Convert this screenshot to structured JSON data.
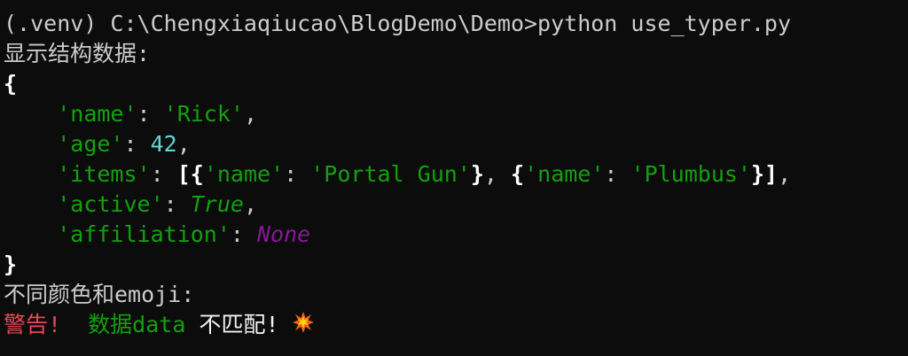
{
  "terminal": {
    "command_line": "(.venv) C:\\Chengxiaqiucao\\BlogDemo\\Demo>python use_typer.py",
    "heading_structured": "显示结构数据:",
    "open_brace": "{",
    "close_brace": "}",
    "indent": "    ",
    "rows": {
      "name": {
        "key": "'name'",
        "sep": ": ",
        "value": "'Rick'",
        "trail": ","
      },
      "age": {
        "key": "'age'",
        "sep": ": ",
        "value": "42",
        "trail": ","
      },
      "items": {
        "key": "'items'",
        "sep": ": ",
        "open_list": "[",
        "item1_open": "{",
        "item1_key": "'name'",
        "item1_sep": ": ",
        "item1_value": "'Portal Gun'",
        "item1_close": "}",
        "between": ", ",
        "item2_open": "{",
        "item2_key": "'name'",
        "item2_sep": ": ",
        "item2_value": "'Plumbus'",
        "item2_close": "}",
        "close_list": "]",
        "trail": ","
      },
      "active": {
        "key": "'active'",
        "sep": ": ",
        "value": "True",
        "trail": ","
      },
      "affiliation": {
        "key": "'affiliation'",
        "sep": ": ",
        "value": "None"
      }
    },
    "heading_colors": "不同颜色和emoji:",
    "warning_red": "警告!",
    "gap": "  ",
    "warning_green": "数据data",
    "warning_white": " 不匹配!",
    "emoji": "collision-icon"
  },
  "colors": {
    "background": "#0c0c0c",
    "foreground": "#cccccc",
    "string_green": "#13a10e",
    "number_cyan": "#61d6d6",
    "none_magenta": "#881798",
    "warning_red": "#e74856"
  }
}
